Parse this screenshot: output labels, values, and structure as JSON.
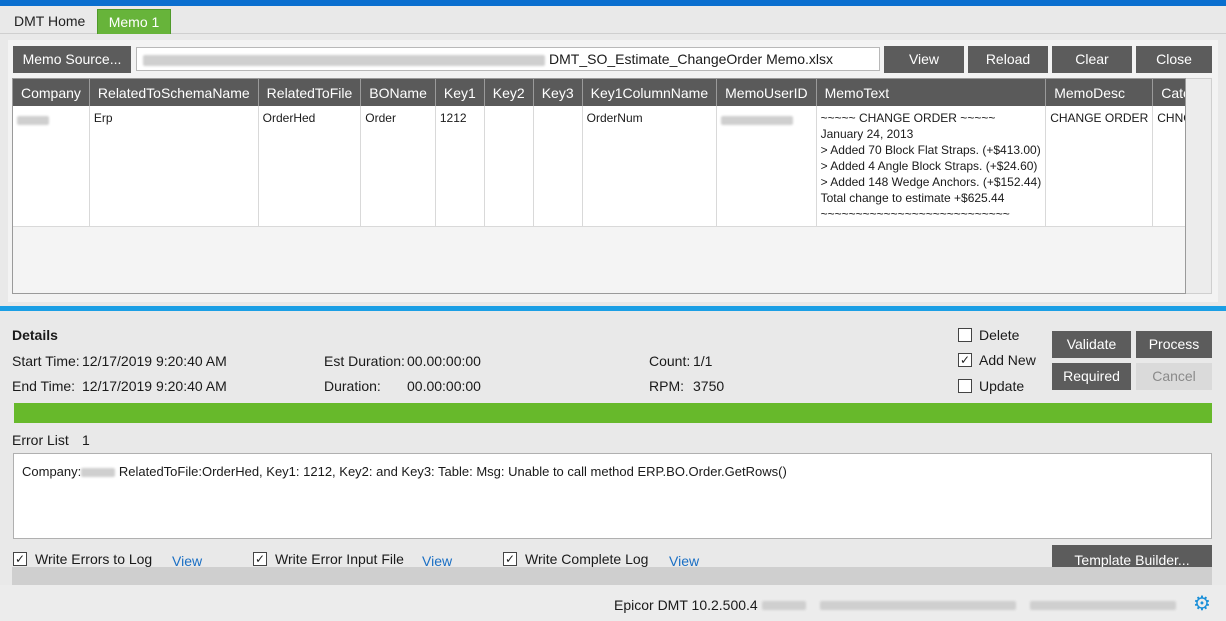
{
  "tabs": [
    {
      "label": "DMT Home",
      "active": false
    },
    {
      "label": "Memo 1",
      "active": true
    }
  ],
  "toolbar": {
    "memo_source_label": "Memo Source...",
    "file_name": "DMT_SO_Estimate_ChangeOrder Memo.xlsx",
    "view_label": "View",
    "reload_label": "Reload",
    "clear_label": "Clear",
    "close_label": "Close"
  },
  "grid": {
    "columns": [
      "Company",
      "RelatedToSchemaName",
      "RelatedToFile",
      "BOName",
      "Key1",
      "Key2",
      "Key3",
      "Key1ColumnName",
      "MemoUserID",
      "MemoText",
      "MemoDesc",
      "CategoryID"
    ],
    "row": {
      "RelatedToSchemaName": "Erp",
      "RelatedToFile": "OrderHed",
      "BOName": "Order",
      "Key1": "1212",
      "Key2": "",
      "Key3": "",
      "Key1ColumnName": "OrderNum",
      "MemoText": [
        "~~~~~ CHANGE ORDER ~~~~~",
        "January 24, 2013",
        "> Added 70 Block Flat Straps. (+$413.00)",
        "> Added 4 Angle Block Straps. (+$24.60)",
        "> Added 148 Wedge Anchors. (+$152.44)",
        "Total change to estimate +$625.44",
        "~~~~~~~~~~~~~~~~~~~~~~~~~~~"
      ],
      "MemoDesc": "CHANGE ORDER",
      "CategoryID": "CHNGORDR"
    }
  },
  "details": {
    "title": "Details",
    "start_label": "Start Time:",
    "start_value": "12/17/2019 9:20:40 AM",
    "end_label": "End Time:",
    "end_value": "12/17/2019 9:20:40 AM",
    "est_duration_label": "Est Duration:",
    "est_duration_value": "00.00:00:00",
    "duration_label": "Duration:",
    "duration_value": "00.00:00:00",
    "count_label": "Count:",
    "count_value": "1/1",
    "rpm_label": "RPM:",
    "rpm_value": "3750"
  },
  "options": {
    "delete_label": "Delete",
    "delete_checked": false,
    "add_new_label": "Add New",
    "add_new_checked": true,
    "update_label": "Update",
    "update_checked": false
  },
  "actions": {
    "validate_label": "Validate",
    "process_label": "Process",
    "required_label": "Required",
    "cancel_label": "Cancel"
  },
  "progress": {
    "percent": 100,
    "color": "#67b92b"
  },
  "errors": {
    "label": "Error List",
    "count": "1",
    "message_prefix": "Company:",
    "message_body": "RelatedToFile:OrderHed, Key1: 1212, Key2:  and Key3:    Table:  Msg: Unable to call method ERP.BO.Order.GetRows()"
  },
  "logging": {
    "write_errors_label": "Write Errors to Log",
    "write_error_input_label": "Write Error Input File",
    "write_complete_label": "Write Complete Log",
    "view_label": "View",
    "template_builder_label": "Template Builder..."
  },
  "status": {
    "version": "Epicor DMT 10.2.500.4",
    "settings_icon": "gear-icon"
  },
  "colors": {
    "accent_blue": "#0a6fcf",
    "tab_active": "#67b43a",
    "button_dark": "#5c5c5c",
    "link": "#1a6fc4"
  }
}
